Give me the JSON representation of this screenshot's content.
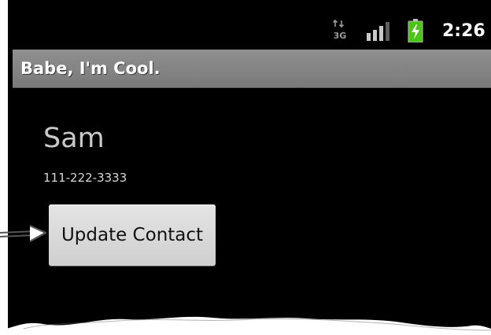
{
  "status_bar": {
    "time": "2:26",
    "network_label": "3G",
    "icons": [
      "network-3g-icon",
      "signal-strength-icon",
      "battery-charging-icon"
    ],
    "battery_color": "#4cc417"
  },
  "app": {
    "title": "Babe, I'm Cool."
  },
  "contact": {
    "name": "Sam",
    "phone": "111-222-3333"
  },
  "actions": {
    "update_label": "Update Contact"
  },
  "colors": {
    "background": "#000000",
    "title_bar": "#858585",
    "button": "#dadada"
  }
}
